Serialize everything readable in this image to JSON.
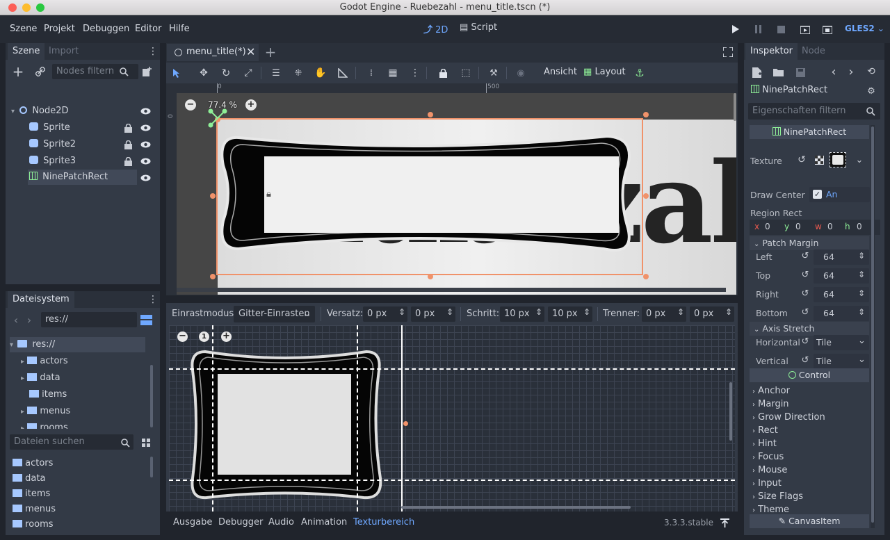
{
  "window": {
    "title": "Godot Engine - Ruebezahl - menu_title.tscn (*)"
  },
  "menubar": {
    "items": [
      "Szene",
      "Projekt",
      "Debuggen",
      "Editor",
      "Hilfe"
    ],
    "mode_2d": "2D",
    "mode_script": "Script",
    "renderer": "GLES2"
  },
  "scene_dock": {
    "tabs": [
      "Szene",
      "Import"
    ],
    "filter_placeholder": "Nodes filtern",
    "nodes": [
      "Node2D",
      "Sprite",
      "Sprite2",
      "Sprite3",
      "NinePatchRect"
    ]
  },
  "fs_dock": {
    "title": "Dateisystem",
    "path": "res://",
    "tree": [
      "res://",
      "actors",
      "data",
      "items",
      "menus",
      "rooms"
    ],
    "search_placeholder": "Dateien suchen",
    "list": [
      "actors",
      "data",
      "items",
      "menus",
      "rooms"
    ]
  },
  "editor": {
    "tab": "menu_title(*)",
    "view_label": "Ansicht",
    "layout_label": "Layout",
    "zoom": "77.4 %",
    "ruler_0": "0",
    "ruler_500": "500",
    "ruler_v0": "0",
    "canvas_text": "Rübezahl"
  },
  "region": {
    "snap_label": "Einrastmodus:",
    "snap_value": "Gitter-Einrasten",
    "offset_label": "Versatz:",
    "offset_x": "0 px",
    "offset_y": "0 px",
    "step_label": "Schritt:",
    "step_x": "10 px",
    "step_y": "10 px",
    "sep_label": "Trenner:",
    "sep_x": "0 px",
    "sep_y": "0 px",
    "zoom_reset": "1"
  },
  "bottom": {
    "tabs": [
      "Ausgabe",
      "Debugger",
      "Audio",
      "Animation",
      "Texturbereich"
    ],
    "version": "3.3.3.stable"
  },
  "inspector": {
    "tabs": [
      "Inspektor",
      "Node"
    ],
    "node": "NinePatchRect",
    "filter_placeholder": "Eigenschaften filtern",
    "class_header": "NinePatchRect",
    "texture_label": "Texture",
    "draw_center_label": "Draw Center",
    "draw_center_value": "An",
    "region_label": "Region Rect",
    "region": {
      "x": "0",
      "y": "0",
      "w": "0",
      "h": "0"
    },
    "patch_margin_label": "Patch Margin",
    "left_label": "Left",
    "left": "64",
    "top_label": "Top",
    "top": "64",
    "right_label": "Right",
    "right": "64",
    "bottom_label": "Bottom",
    "bottom": "64",
    "axis_label": "Axis Stretch",
    "horizontal_label": "Horizontal",
    "horizontal": "Tile",
    "vertical_label": "Vertical",
    "vertical": "Tile",
    "control_header": "Control",
    "sections": [
      "Anchor",
      "Margin",
      "Grow Direction",
      "Rect",
      "Hint",
      "Focus",
      "Mouse",
      "Input",
      "Size Flags",
      "Theme"
    ],
    "canvasitem_header": "CanvasItem"
  },
  "colors": {
    "accent": "#6fa8ff",
    "selection": "#f0926a",
    "green": "#8eef97",
    "bg": "#20242c"
  }
}
